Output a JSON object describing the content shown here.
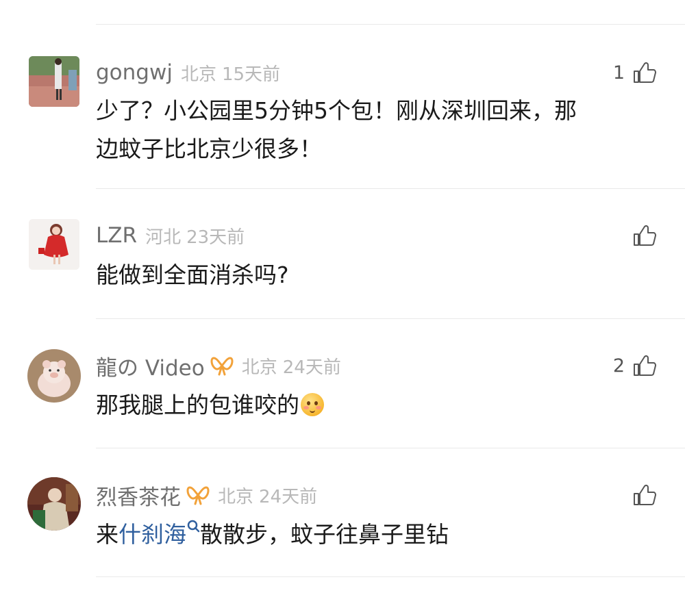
{
  "colors": {
    "username": "#6f6f6f",
    "meta": "#b8b8b8",
    "link": "#2f5f9e",
    "divider": "#e9e9e9"
  },
  "comments": [
    {
      "username": "gongwj",
      "location": "北京",
      "time": "15天前",
      "likes": "1",
      "avatar": "street-photo-avatar",
      "text_lines": [
        "少了？小公园里5分钟5个包！刚从深圳回来，那",
        "边蚊子比北京少很多！"
      ]
    },
    {
      "username": "LZR",
      "location": "河北",
      "time": "23天前",
      "likes": "",
      "avatar": "girl-in-red-dress-avatar",
      "text": "能做到全面消杀吗?"
    },
    {
      "username": "龍の Video",
      "badge": "vip-ribbon-icon",
      "location": "北京",
      "time": "24天前",
      "likes": "2",
      "avatar": "pig-toy-avatar",
      "text": "那我腿上的包谁咬的",
      "emoji": "blush-emoji"
    },
    {
      "username": "烈香茶花",
      "badge": "vip-ribbon-icon",
      "location": "北京",
      "time": "24天前",
      "likes": "",
      "avatar": "painting-portrait-avatar",
      "text_prefix": "来",
      "text_link": "什刹海",
      "link_icon": "search-icon",
      "text_suffix": "散散步，蚊子往鼻子里钻"
    }
  ]
}
